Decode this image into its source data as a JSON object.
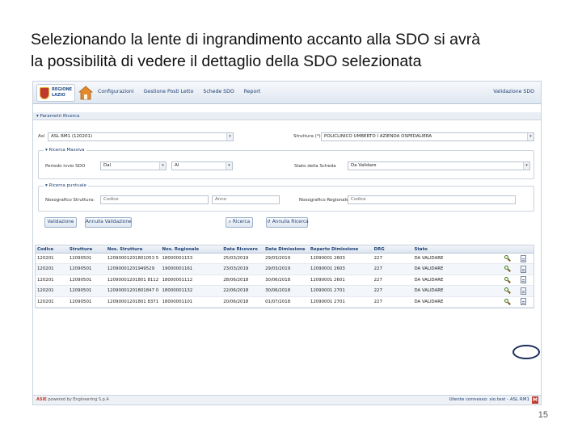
{
  "slide": {
    "text_line1": "Selezionando la lente di ingrandimento accanto alla SDO si avrà",
    "text_line2": "la possibilità di vedere il dettaglio della SDO selezionata",
    "page_number": "15"
  },
  "app": {
    "logo_text_line1": "REGIONE",
    "logo_text_line2": "LAZIO",
    "nav": [
      "Configurazioni",
      "Gestione Posti Letto",
      "Schede SDO",
      "Report"
    ],
    "validazione_link": "Validazione SDO",
    "filters_title": "▾ Parametri Ricerca",
    "asl_label": "Asl",
    "asl_value": "ASL RM1 (120201)",
    "struttura_label": "Struttura (*)",
    "struttura_value": "POLICLINICO UMBERTO I AZIENDA OSPEDALIERA",
    "ricerca_massiva": {
      "legend": "▾ Ricerca Massiva",
      "periodo_label": "Periodo invio SDO",
      "dal_value": "Dal",
      "al_value": "Al",
      "stato_label": "Stato della Scheda",
      "stato_value": "Da Validare"
    },
    "ricerca_puntuale": {
      "legend": "▾ Ricerca puntuale",
      "nosografico_struttura_label": "Nosografico Struttura:",
      "codice_placeholder": "Codice",
      "anno_placeholder": "Anno",
      "nosografico_regionale_label": "Nosografico Regionale:",
      "codice_regionale_placeholder": "Codice"
    },
    "buttons": {
      "validazione": "Validazione",
      "annulla_validazione": "Annulla Validazione",
      "ricerca": "Ricerca",
      "annulla_ricerca": "Annulla Ricerca"
    },
    "table": {
      "headers": [
        "Codice",
        "Struttura",
        "Nos. Struttura",
        "Nos. Regionale",
        "Data Ricovero",
        "Data Dimissione",
        "Reparto Dimissione",
        "DRG",
        "Stato",
        "",
        "",
        ""
      ],
      "rows": [
        [
          "120201",
          "12090501",
          "12090001201801053 5",
          "18000001153",
          "25/03/2019",
          "29/03/2019",
          "12090001 2603",
          "227",
          "DA VALIDARE"
        ],
        [
          "120201",
          "12090501",
          "12090001201949529",
          "19000001161",
          "23/03/2019",
          "29/03/2019",
          "12090001 2603",
          "227",
          "DA VALIDARE"
        ],
        [
          "120201",
          "12090501",
          "12090001201801 8112",
          "18000001112",
          "28/06/2018",
          "30/06/2018",
          "12090001 2601",
          "227",
          "DA VALIDARE"
        ],
        [
          "120201",
          "12090501",
          "12090001201801847 0",
          "18000001132",
          "22/06/2018",
          "30/06/2018",
          "12090001 2701",
          "227",
          "DA VALIDARE"
        ],
        [
          "120201",
          "12090501",
          "12090001201801 8371",
          "18000001101",
          "20/06/2018",
          "01/07/2018",
          "12090001 2701",
          "227",
          "DA VALIDARE"
        ]
      ]
    },
    "footer": {
      "brand": "ASIE",
      "powered": "powered by Engineering S.p.A",
      "user": "Utente connesso: sio.test - ASL RM1",
      "m_icon": "M"
    }
  }
}
